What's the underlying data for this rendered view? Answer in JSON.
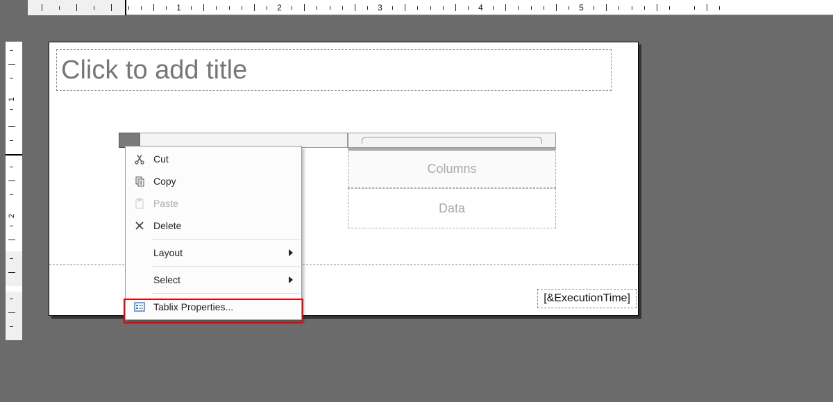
{
  "ruler": {
    "h_numbers": [
      "1",
      "2",
      "3",
      "4",
      "5"
    ],
    "v_numbers": [
      "1",
      "2"
    ]
  },
  "page": {
    "title_placeholder": "Click to add title",
    "tablix": {
      "columns_label": "Columns",
      "data_label": "Data"
    },
    "footer_expr": "[&ExecutionTime]"
  },
  "context_menu": {
    "cut": "Cut",
    "copy": "Copy",
    "paste": "Paste",
    "delete": "Delete",
    "layout": "Layout",
    "select": "Select",
    "tablix_properties": "Tablix Properties..."
  }
}
